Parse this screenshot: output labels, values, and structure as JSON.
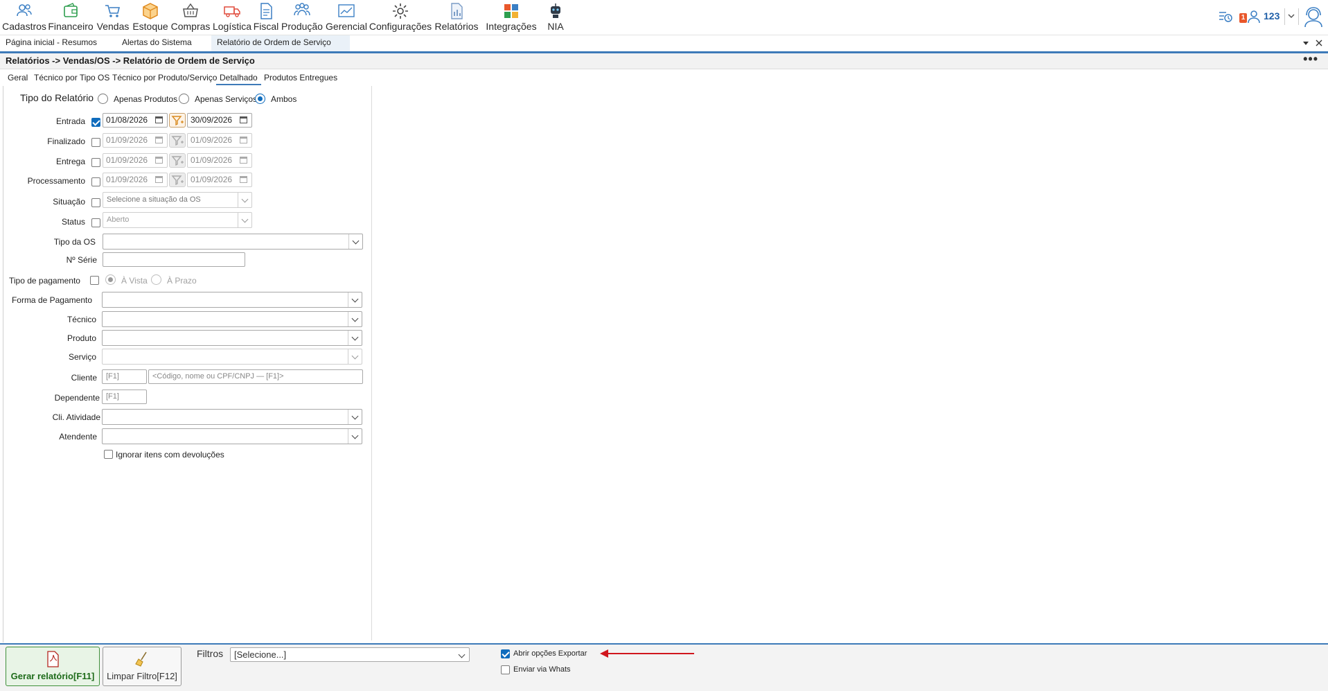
{
  "toolbar": {
    "items": [
      {
        "label": "Cadastros",
        "icon": "users-icon"
      },
      {
        "label": "Financeiro",
        "icon": "wallet-icon"
      },
      {
        "label": "Vendas",
        "icon": "cart-icon"
      },
      {
        "label": "Estoque",
        "icon": "box-icon"
      },
      {
        "label": "Compras",
        "icon": "basket-icon"
      },
      {
        "label": "Logística",
        "icon": "truck-icon"
      },
      {
        "label": "Fiscal",
        "icon": "document-icon"
      },
      {
        "label": "Produção",
        "icon": "production-icon"
      },
      {
        "label": "Gerencial",
        "icon": "chart-icon"
      },
      {
        "label": "Configurações",
        "icon": "gear-icon"
      },
      {
        "label": "Relatórios",
        "icon": "report-icon"
      },
      {
        "label": "Integrações",
        "icon": "integration-icon"
      },
      {
        "label": "NIA",
        "icon": "robot-icon"
      }
    ],
    "notification_count": "1",
    "user_id": "123"
  },
  "tabs": [
    {
      "label": "Página inicial - Resumos"
    },
    {
      "label": "Alertas do Sistema"
    },
    {
      "label": "Relatório de Ordem de Serviço"
    }
  ],
  "breadcrumb": "Relatórios -> Vendas/OS -> Relatório de Ordem de Serviço",
  "subtabs": [
    {
      "label": "Geral"
    },
    {
      "label": "Técnico por Tipo OS"
    },
    {
      "label": "Técnico por Produto/Serviço"
    },
    {
      "label": "Detalhado"
    },
    {
      "label": "Produtos Entregues"
    }
  ],
  "form": {
    "tipo_relatorio": {
      "label": "Tipo do Relatório",
      "options": [
        "Apenas Produtos",
        "Apenas Serviços",
        "Ambos"
      ],
      "selected": "Ambos"
    },
    "entrada": {
      "label": "Entrada",
      "checked": true,
      "from": "01/08/2026",
      "to": "30/09/2026"
    },
    "finalizado": {
      "label": "Finalizado",
      "checked": false,
      "from": "01/09/2026",
      "to": "01/09/2026"
    },
    "entrega": {
      "label": "Entrega",
      "checked": false,
      "from": "01/09/2026",
      "to": "01/09/2026"
    },
    "processamento": {
      "label": "Processamento",
      "checked": false,
      "from": "01/09/2026",
      "to": "01/09/2026"
    },
    "situacao": {
      "label": "Situação",
      "placeholder": "Selecione a situação da OS"
    },
    "status": {
      "label": "Status",
      "value": "Aberto"
    },
    "tipo_os": {
      "label": "Tipo da OS",
      "value": ""
    },
    "num_serie": {
      "label": "Nº Série",
      "value": ""
    },
    "tipo_pagamento": {
      "label": "Tipo de pagamento",
      "options": [
        "À Vista",
        "À Prazo"
      ],
      "selected": "À Vista"
    },
    "forma_pagamento": {
      "label": "Forma de Pagamento",
      "value": ""
    },
    "tecnico": {
      "label": "Técnico",
      "value": ""
    },
    "produto": {
      "label": "Produto",
      "value": ""
    },
    "servico": {
      "label": "Serviço",
      "value": ""
    },
    "cliente": {
      "label": "Cliente",
      "code_placeholder": "[F1]",
      "search_placeholder": "<Código, nome ou CPF/CNPJ — [F1]>"
    },
    "dependente": {
      "label": "Dependente",
      "code_placeholder": "[F1]"
    },
    "cli_atividade": {
      "label": "Cli. Atividade",
      "value": ""
    },
    "atendente": {
      "label": "Atendente",
      "value": ""
    },
    "ignorar_devolucoes": {
      "label": "Ignorar itens com devoluções",
      "checked": false
    }
  },
  "footer": {
    "generate_label": "Gerar relatório[F11]",
    "clear_label": "Limpar Filtro[F12]",
    "filters_label": "Filtros",
    "filters_value": "[Selecione...]",
    "export_label": "Abrir opções Exportar",
    "export_checked": true,
    "whats_label": "Enviar via Whats",
    "whats_checked": false
  },
  "colors": {
    "accent": "#3d7ab8",
    "check_blue": "#0f6cbd",
    "primary_green": "#1e6b1a",
    "annotation_red": "#d0161d"
  }
}
